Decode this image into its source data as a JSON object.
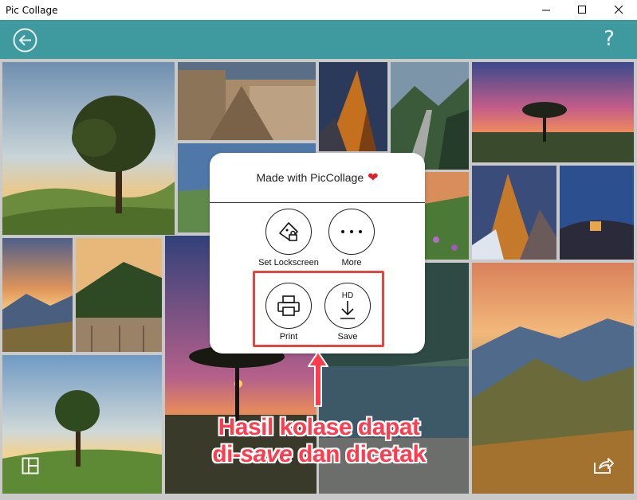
{
  "window": {
    "title": "Pic Collage"
  },
  "appbar": {
    "help_label": "?"
  },
  "popup": {
    "heading": "Made with PicCollage",
    "heart": "❤",
    "actions": {
      "lockscreen": "Set Lockscreen",
      "more": "More",
      "print": "Print",
      "save": "Save",
      "save_badge": "HD"
    }
  },
  "annotation": {
    "line1": "Hasil kolase dapat",
    "line2_prefix": "di-",
    "line2_italic": "save",
    "line2_suffix": " dan dicetak"
  },
  "colors": {
    "appbar": "#3f9a9f",
    "annotation": "#ff3b4e",
    "highlight": "#e9453f",
    "heart": "#d9222a"
  }
}
